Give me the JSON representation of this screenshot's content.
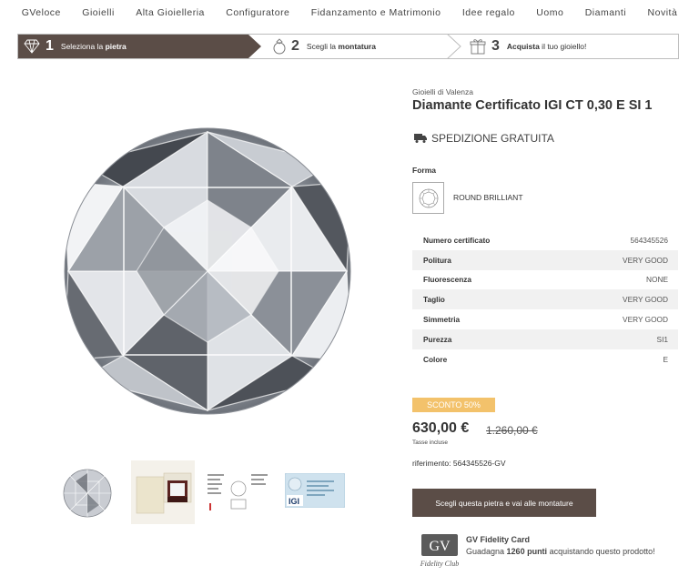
{
  "nav": {
    "items": [
      "GVeloce",
      "Gioielli",
      "Alta Gioielleria",
      "Configuratore",
      "Fidanzamento e Matrimonio",
      "Idee regalo",
      "Uomo",
      "Diamanti",
      "Novità"
    ]
  },
  "steps": [
    {
      "num": "1",
      "pre": "Seleziona la ",
      "bold": "pietra",
      "post": "",
      "icon": "diamond-icon",
      "active": true
    },
    {
      "num": "2",
      "pre": "Scegli la ",
      "bold": "montatura",
      "post": "",
      "icon": "ring-icon",
      "active": false
    },
    {
      "num": "3",
      "pre": "",
      "bold": "Acquista",
      "post": " il tuo gioiello!",
      "icon": "gift-icon",
      "active": false
    }
  ],
  "product": {
    "brand": "Gioielli di Valenza",
    "title": "Diamante Certificato IGI CT 0,30 E SI 1",
    "shipping": "SPEDIZIONE GRATUITA",
    "shape_label": "Forma",
    "shape_name": "ROUND BRILLIANT",
    "specs": [
      {
        "label": "Numero certificato",
        "value": "564345526"
      },
      {
        "label": "Politura",
        "value": "VERY GOOD"
      },
      {
        "label": "Fluorescenza",
        "value": "NONE"
      },
      {
        "label": "Taglio",
        "value": "VERY GOOD"
      },
      {
        "label": "Simmetria",
        "value": "VERY GOOD"
      },
      {
        "label": "Purezza",
        "value": "SI1"
      },
      {
        "label": "Colore",
        "value": "E"
      }
    ],
    "discount_badge": "SCONTO 50%",
    "price": "630,00 €",
    "old_price": "1.260,00 €",
    "tax_note": "Tasse incluse",
    "reference": "riferimento: 564345526-GV",
    "cta": "Scegli questa pietra e vai alle montature"
  },
  "fidelity": {
    "logo_text": "GV",
    "logo_sub": "Fidelity Club",
    "title": "GV Fidelity Card",
    "text_pre": "Guadagna ",
    "points": "1260 punti",
    "text_post": " acquistando questo prodotto!"
  },
  "colors": {
    "accent": "#5b4d47",
    "badge": "#f3c26b"
  }
}
